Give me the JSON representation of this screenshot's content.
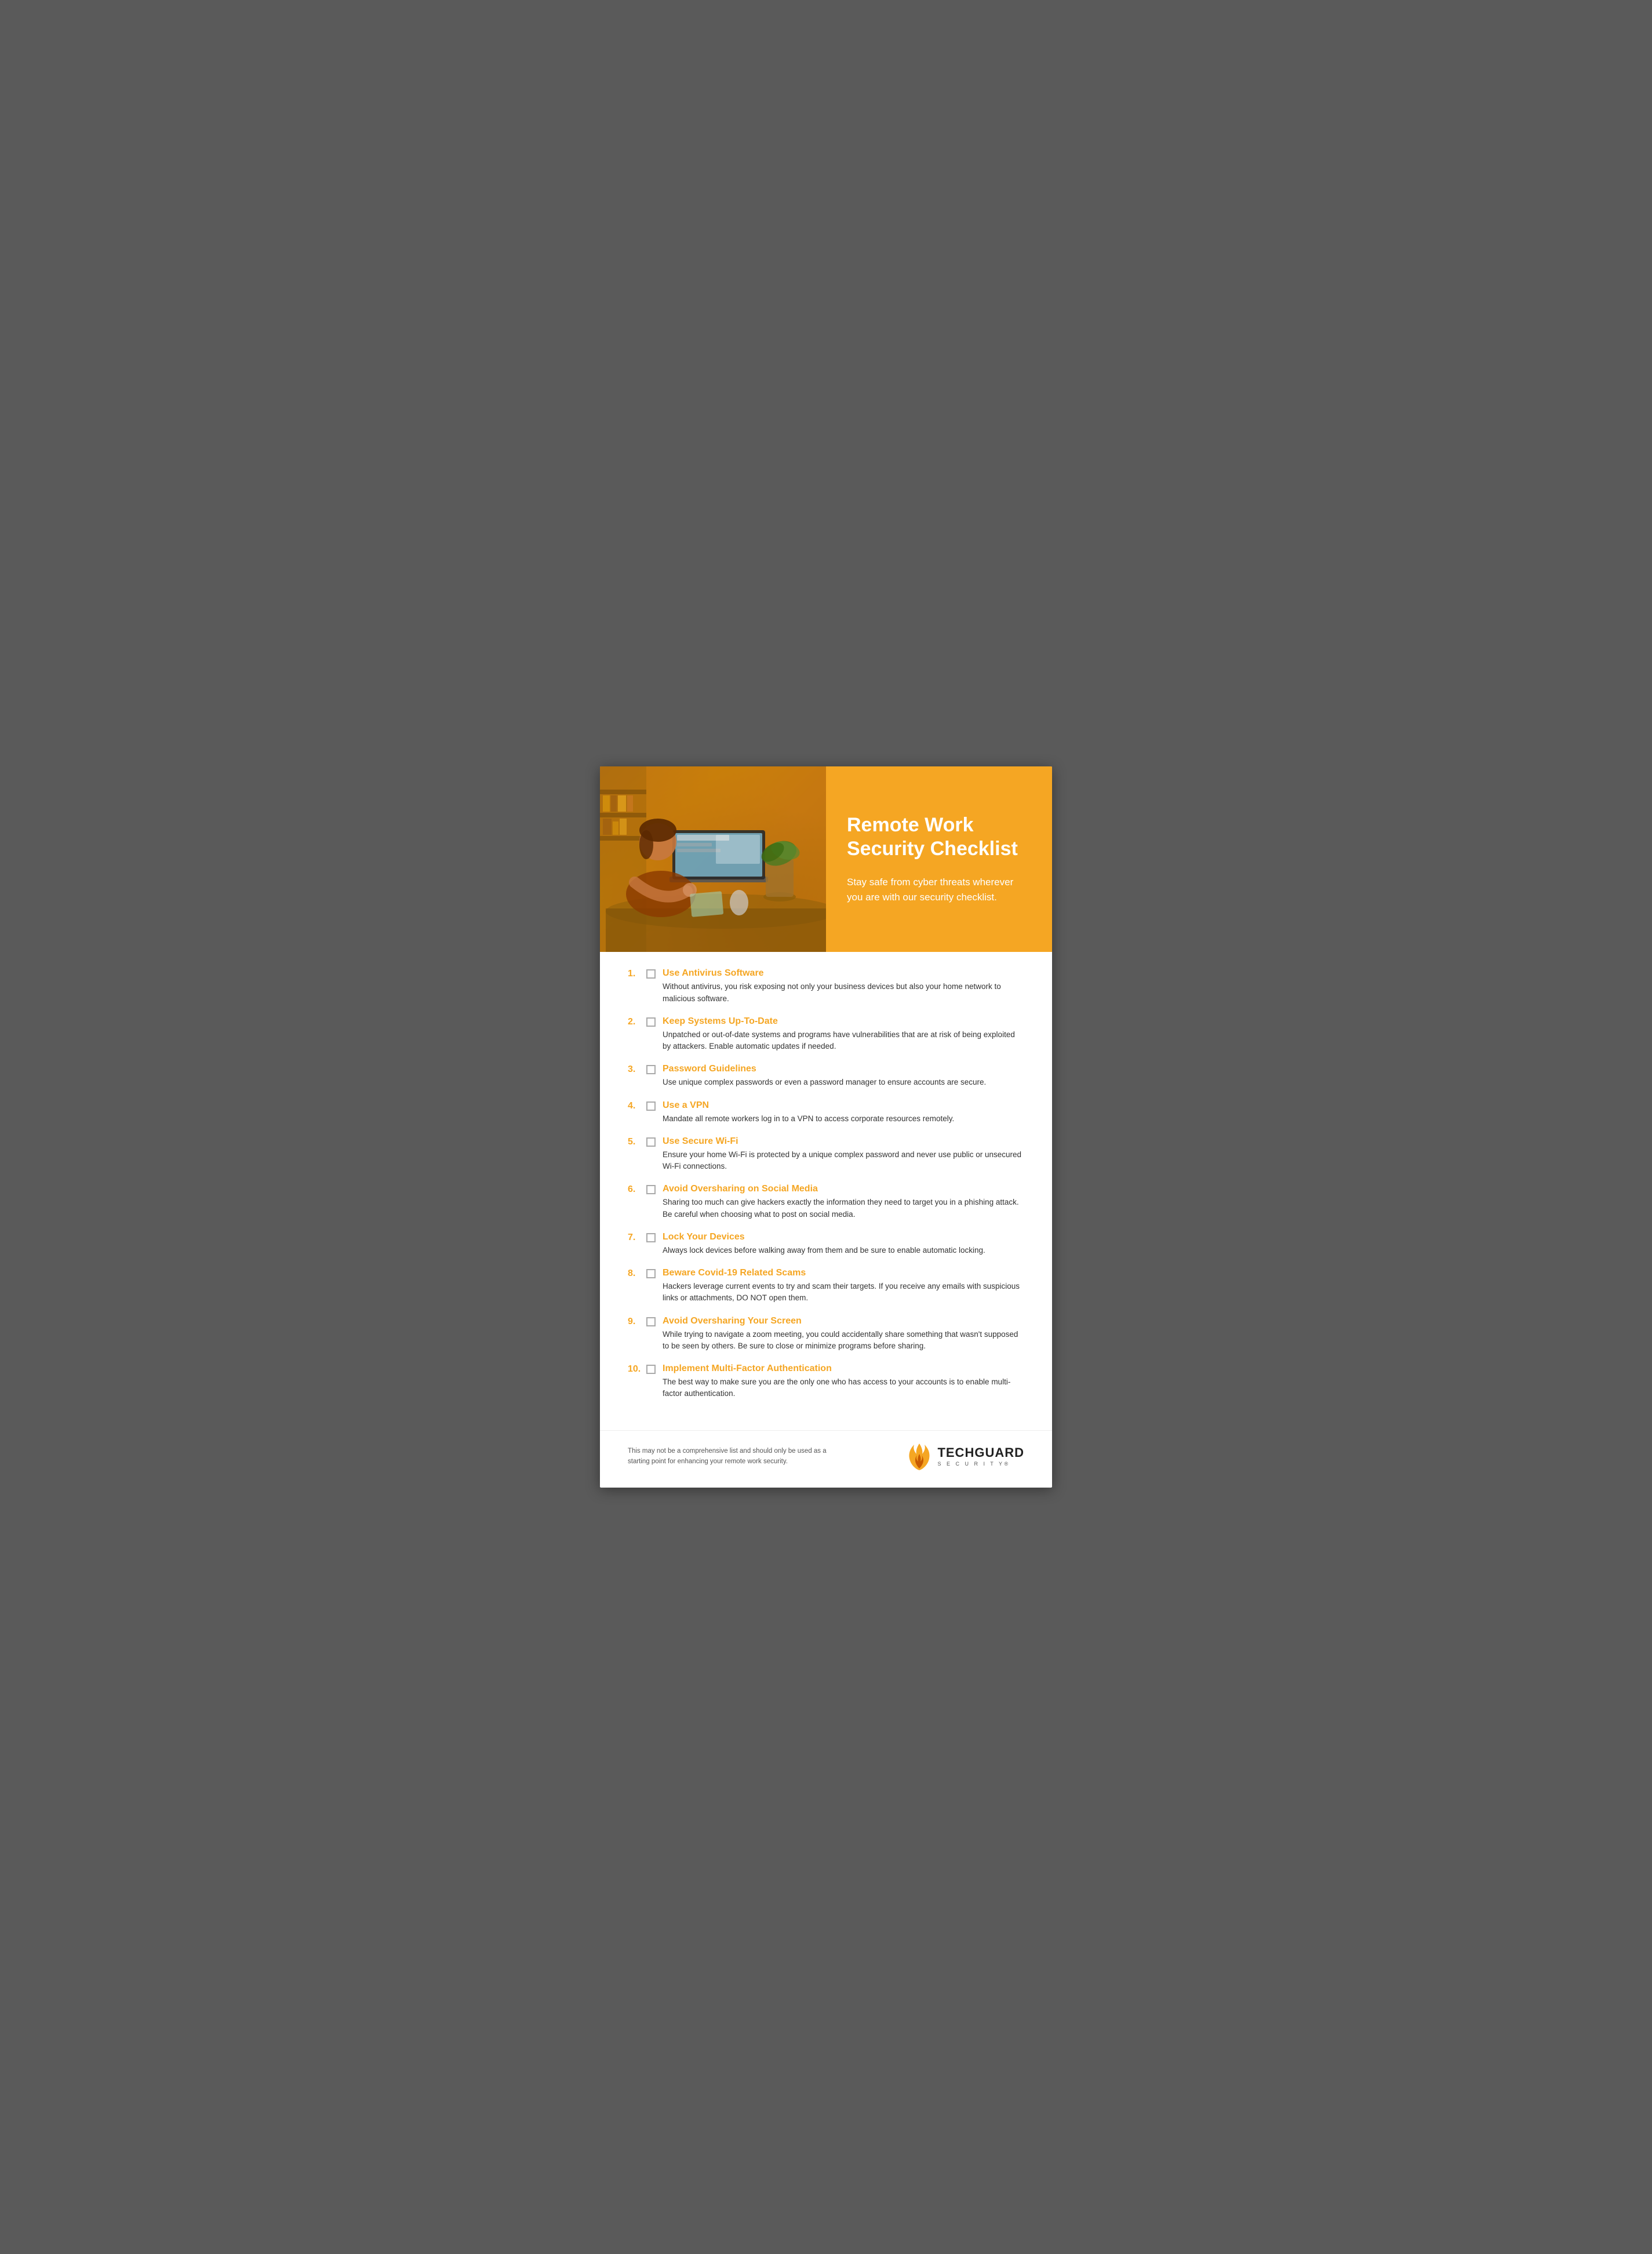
{
  "header": {
    "title_line1": "Remote Work",
    "title_line2": "Security Checklist",
    "subtitle": "Stay safe from cyber threats wherever you are with our security checklist."
  },
  "checklist": {
    "items": [
      {
        "number": "1.",
        "title": "Use Antivirus Software",
        "description": "Without antivirus, you risk exposing not only your business devices but also your home network to malicious software."
      },
      {
        "number": "2.",
        "title": "Keep Systems Up-To-Date",
        "description": "Unpatched or out-of-date systems and programs have vulnerabilities that are at risk of being exploited by attackers. Enable automatic updates if needed."
      },
      {
        "number": "3.",
        "title": "Password Guidelines",
        "description": "Use unique complex passwords or even a password manager to ensure accounts are secure."
      },
      {
        "number": "4.",
        "title": "Use a VPN",
        "description": "Mandate all remote workers log in to a VPN to access corporate resources remotely."
      },
      {
        "number": "5.",
        "title": "Use Secure Wi-Fi",
        "description": "Ensure your home Wi-Fi is protected by a unique complex password and never use public or unsecured Wi-Fi connections."
      },
      {
        "number": "6.",
        "title": "Avoid Oversharing on Social Media",
        "description": "Sharing too much can give hackers exactly the information they need to target you in a phishing attack. Be careful when choosing what to post on social media."
      },
      {
        "number": "7.",
        "title": "Lock Your Devices",
        "description": "Always lock devices before walking away from them and be sure to enable automatic locking."
      },
      {
        "number": "8.",
        "title": "Beware Covid-19 Related Scams",
        "description": "Hackers leverage current events to try and scam their targets. If you receive any emails with suspicious links or attachments, DO NOT open them."
      },
      {
        "number": "9.",
        "title": "Avoid Oversharing Your Screen",
        "description": "While trying to navigate a zoom meeting, you could accidentally share something that wasn't supposed to be seen by others. Be sure to close or minimize programs before sharing."
      },
      {
        "number": "10.",
        "title": "Implement Multi-Factor Authentication",
        "description": "The best way to make sure you are the only one who has access to your accounts is to enable multi-factor authentication."
      }
    ]
  },
  "footer": {
    "disclaimer": "This may not be a comprehensive list and should only be used as a starting point for enhancing your remote work security.",
    "logo_name": "TECHGUARD",
    "logo_sub": "S E C U R I T Y®"
  }
}
